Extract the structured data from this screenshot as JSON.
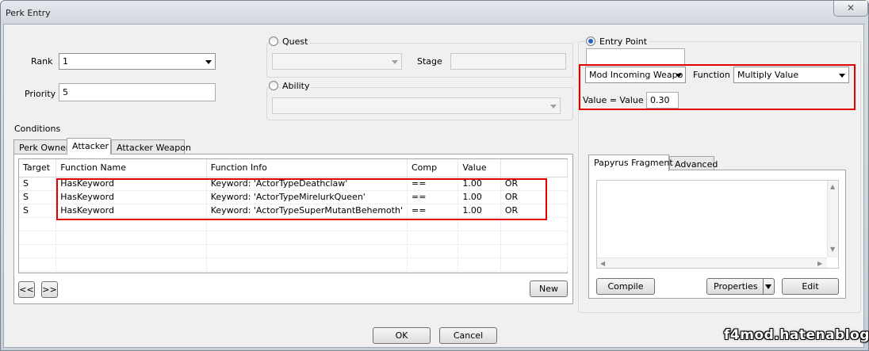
{
  "window": {
    "title": "Perk Entry",
    "close_glyph": "✕"
  },
  "rank": {
    "label": "Rank",
    "value": "1"
  },
  "priority": {
    "label": "Priority",
    "value": "5"
  },
  "quest": {
    "label": "Quest",
    "value": "",
    "stage_label": "Stage",
    "stage_value": ""
  },
  "ability": {
    "label": "Ability",
    "value": ""
  },
  "entry_point": {
    "label": "Entry Point",
    "name_value": "",
    "dropdown_value": "Mod Incoming Weapo",
    "function_label": "Function",
    "function_value": "Multiply Value",
    "value_label": "Value = Value *",
    "value": "0.30"
  },
  "conditions": {
    "label": "Conditions",
    "tabs": [
      "Perk Owner",
      "Attacker",
      "Attacker Weapon"
    ],
    "active_tab": "Attacker",
    "columns": [
      "Target",
      "Function Name",
      "Function Info",
      "Comp",
      "Value",
      ""
    ],
    "rows": [
      [
        "S",
        "HasKeyword",
        "Keyword: 'ActorTypeDeathclaw'",
        "==",
        "1.00",
        "OR"
      ],
      [
        "S",
        "HasKeyword",
        "Keyword: 'ActorTypeMirelurkQueen'",
        "==",
        "1.00",
        "OR"
      ],
      [
        "S",
        "HasKeyword",
        "Keyword: 'ActorTypeSuperMutantBehemoth'",
        "==",
        "1.00",
        "OR"
      ]
    ],
    "prev_label": "<<",
    "next_label": ">>",
    "new_label": "New"
  },
  "papyrus": {
    "tabs": [
      "Papyrus Fragment",
      "Advanced"
    ],
    "active_tab": "Papyrus Fragment",
    "compile_label": "Compile",
    "properties_label": "Properties",
    "edit_label": "Edit"
  },
  "footer": {
    "ok_label": "OK",
    "cancel_label": "Cancel"
  },
  "watermark": "f4mod.hatenablog.com",
  "colors": {
    "highlight": "#e00000",
    "radio_selected": "#2a62c8"
  }
}
